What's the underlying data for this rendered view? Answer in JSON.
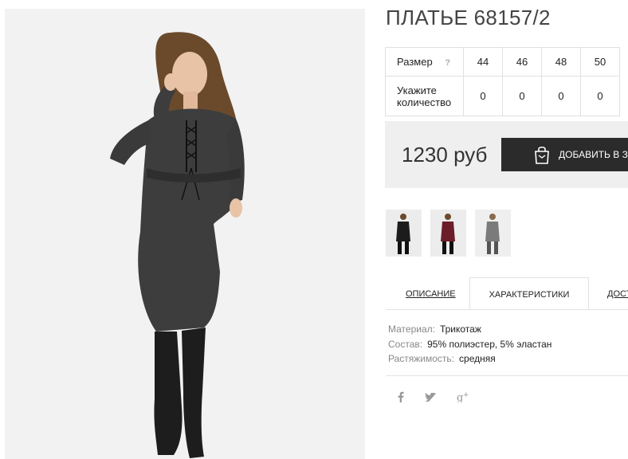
{
  "product": {
    "title": "ПЛАТЬЕ 68157/2",
    "price": "1230 руб",
    "add_to_cart_label": "ДОБАВИТЬ В ЗА"
  },
  "size_table": {
    "size_label": "Размер",
    "help_mark": "?",
    "sizes": [
      "44",
      "46",
      "48",
      "50"
    ],
    "qty_label_line1": "Укажите",
    "qty_label_line2": "количество",
    "quantities": [
      "0",
      "0",
      "0",
      "0"
    ]
  },
  "thumbnails": [
    {
      "color": "black",
      "hex": "#1c1c1c"
    },
    {
      "color": "burgundy",
      "hex": "#6b1e2a"
    },
    {
      "color": "grey",
      "hex": "#7b7b7b"
    }
  ],
  "tabs": [
    {
      "label": "ОПИСАНИЕ",
      "active": false
    },
    {
      "label": "ХАРАКТЕРИСТИКИ",
      "active": true
    },
    {
      "label": "ДОСТ",
      "active": false
    }
  ],
  "characteristics": [
    {
      "key": "Материал:",
      "value": "Трикотаж"
    },
    {
      "key": "Состав:",
      "value": "95% полиэстер, 5% эластан"
    },
    {
      "key": "Растяжимость:",
      "value": "средняя"
    }
  ],
  "social": [
    {
      "icon": "facebook-icon",
      "glyph": "f"
    },
    {
      "icon": "twitter-icon",
      "glyph": "❧"
    },
    {
      "icon": "google-plus-icon",
      "glyph": "g+"
    }
  ],
  "colors": {
    "button_bg": "#2b2b2b",
    "price_box_bg": "#efefef",
    "dress": "#3d3d3d"
  }
}
